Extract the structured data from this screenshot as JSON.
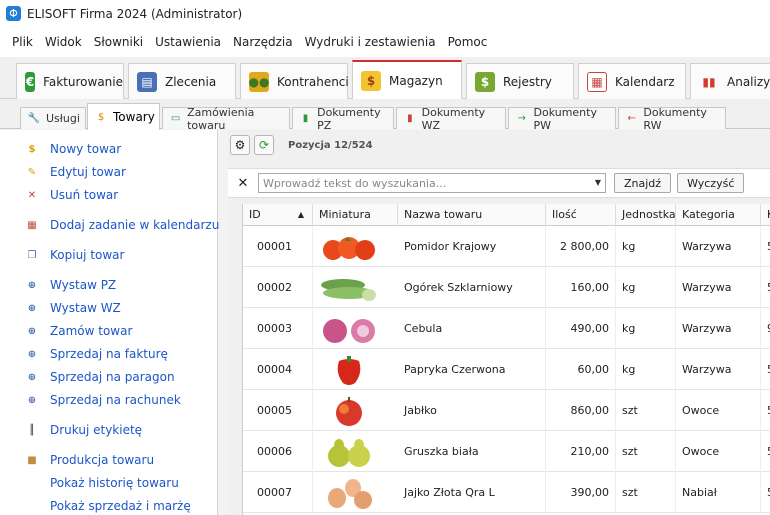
{
  "window": {
    "title": "ELISOFT Firma 2024 (Administrator)"
  },
  "menu": [
    "Plik",
    "Widok",
    "Słowniki",
    "Ustawienia",
    "Narzędzia",
    "Wydruki i zestawienia",
    "Pomoc"
  ],
  "modules": [
    {
      "label": "Fakturowanie",
      "icon": "euro-icon",
      "color": "#2e9a3c"
    },
    {
      "label": "Zlecenia",
      "icon": "documents-icon",
      "color": "#4a6fb5"
    },
    {
      "label": "Kontrahenci",
      "icon": "people-icon",
      "color": "#e0a81b"
    },
    {
      "label": "Magazyn",
      "icon": "money-bags-icon",
      "color": "#d6a300"
    },
    {
      "label": "Rejestry",
      "icon": "register-icon",
      "color": "#79a832"
    },
    {
      "label": "Kalendarz",
      "icon": "calendar-icon",
      "color": "#c4453b"
    },
    {
      "label": "Analizy",
      "icon": "bar-chart-icon",
      "color": "#d63a2c"
    }
  ],
  "subtabs": [
    {
      "label": "Usługi",
      "icon": "wrench-icon"
    },
    {
      "label": "Towary",
      "icon": "money-bags-icon"
    },
    {
      "label": "Zamówienia towaru",
      "icon": "cart-icon"
    },
    {
      "label": "Dokumenty PZ",
      "icon": "bottle-green-icon"
    },
    {
      "label": "Dokumenty WZ",
      "icon": "bottle-red-icon"
    },
    {
      "label": "Dokumenty PW",
      "icon": "arrow-green-icon"
    },
    {
      "label": "Dokumenty RW",
      "icon": "arrow-red-icon"
    }
  ],
  "sidebar": [
    {
      "label": "Nowy towar",
      "icon": "money-bag-icon"
    },
    {
      "label": "Edytuj towar",
      "icon": "money-bag-edit-icon"
    },
    {
      "label": "Usuń towar",
      "icon": "money-bag-delete-icon"
    },
    {
      "label": "Dodaj zadanie w kalendarzu",
      "icon": "calendar-icon"
    },
    {
      "label": "Kopiuj towar",
      "icon": "copy-icon"
    },
    {
      "label": "Wystaw PZ",
      "icon": "document-add-icon"
    },
    {
      "label": "Wystaw WZ",
      "icon": "document-add-icon"
    },
    {
      "label": "Zamów towar",
      "icon": "document-add-icon"
    },
    {
      "label": "Sprzedaj na fakturę",
      "icon": "document-add-icon"
    },
    {
      "label": "Sprzedaj na paragon",
      "icon": "document-add-icon"
    },
    {
      "label": "Sprzedaj na rachunek",
      "icon": "document-add-icon"
    },
    {
      "label": "Drukuj etykietę",
      "icon": "barcode-icon"
    },
    {
      "label": "Produkcja towaru",
      "icon": "box-icon"
    },
    {
      "label": "Pokaż historię towaru",
      "icon": ""
    },
    {
      "label": "Pokaż sprzedaż i marżę",
      "icon": ""
    }
  ],
  "toolbar": {
    "position": "Pozycja 12/524"
  },
  "search": {
    "placeholder": "Wprowadź tekst do wyszukania...",
    "find": "Znajdź",
    "clear": "Wyczyść"
  },
  "columns": [
    "ID",
    "Miniatura",
    "Nazwa towaru",
    "Ilość",
    "Jednostka",
    "Kategoria",
    "Ko"
  ],
  "rows": [
    {
      "id": "00001",
      "thumb": "tomatoes",
      "name": "Pomidor Krajowy",
      "qty": "2 800,00",
      "unit": "kg",
      "category": "Warzywa",
      "extra": "5"
    },
    {
      "id": "00002",
      "thumb": "cucumbers",
      "name": "Ogórek Szklarniowy",
      "qty": "160,00",
      "unit": "kg",
      "category": "Warzywa",
      "extra": "5"
    },
    {
      "id": "00003",
      "thumb": "onions",
      "name": "Cebula",
      "qty": "490,00",
      "unit": "kg",
      "category": "Warzywa",
      "extra": "9"
    },
    {
      "id": "00004",
      "thumb": "pepper",
      "name": "Papryka Czerwona",
      "qty": "60,00",
      "unit": "kg",
      "category": "Warzywa",
      "extra": "5"
    },
    {
      "id": "00005",
      "thumb": "apple",
      "name": "Jabłko",
      "qty": "860,00",
      "unit": "szt",
      "category": "Owoce",
      "extra": "5"
    },
    {
      "id": "00006",
      "thumb": "pears",
      "name": "Gruszka biała",
      "qty": "210,00",
      "unit": "szt",
      "category": "Owoce",
      "extra": "5"
    },
    {
      "id": "00007",
      "thumb": "eggs",
      "name": "Jajko Złota Qra L",
      "qty": "390,00",
      "unit": "szt",
      "category": "Nabiał",
      "extra": "5"
    }
  ]
}
